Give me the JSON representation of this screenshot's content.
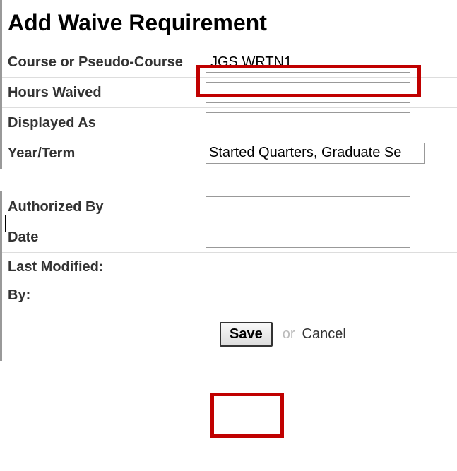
{
  "title": "Add Waive Requirement",
  "fields": {
    "course": {
      "label": "Course or Pseudo-Course",
      "value": "JGS WRTN1"
    },
    "hours": {
      "label": "Hours Waived",
      "value": ""
    },
    "displayed": {
      "label": "Displayed As",
      "value": ""
    },
    "yearterm": {
      "label": "Year/Term",
      "value": "Started Quarters, Graduate Se"
    },
    "authorized": {
      "label": "Authorized By",
      "value": ""
    },
    "date": {
      "label": "Date",
      "value": ""
    },
    "lastmod": {
      "label": "Last Modified:"
    },
    "by": {
      "label": "By:"
    }
  },
  "buttons": {
    "save": "Save",
    "or": "or",
    "cancel": "Cancel"
  }
}
